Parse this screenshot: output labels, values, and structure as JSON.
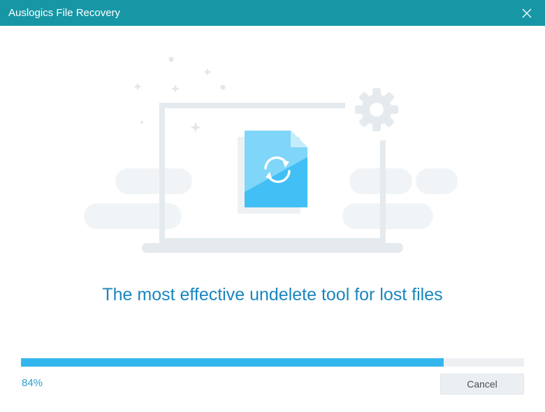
{
  "window": {
    "title": "Auslogics File Recovery",
    "close_icon": "close-icon"
  },
  "illustration": {
    "icons": [
      "laptop-icon",
      "file-recovery-icon",
      "gear-icon",
      "sparkle-icon",
      "cloud-shape"
    ],
    "colors": {
      "primary_blue": "#42bff4",
      "light_blue": "#7fd6f8",
      "outline_gray": "#e4eaee",
      "cloud_gray": "#f1f4f6"
    }
  },
  "main": {
    "headline": "The most effective undelete tool for lost files"
  },
  "progress": {
    "value_percent": 84,
    "label": "84%"
  },
  "buttons": {
    "cancel_label": "Cancel"
  },
  "theme": {
    "titlebar": "#1797a6",
    "accent": "#33b6ee",
    "headline": "#1a86bf"
  }
}
